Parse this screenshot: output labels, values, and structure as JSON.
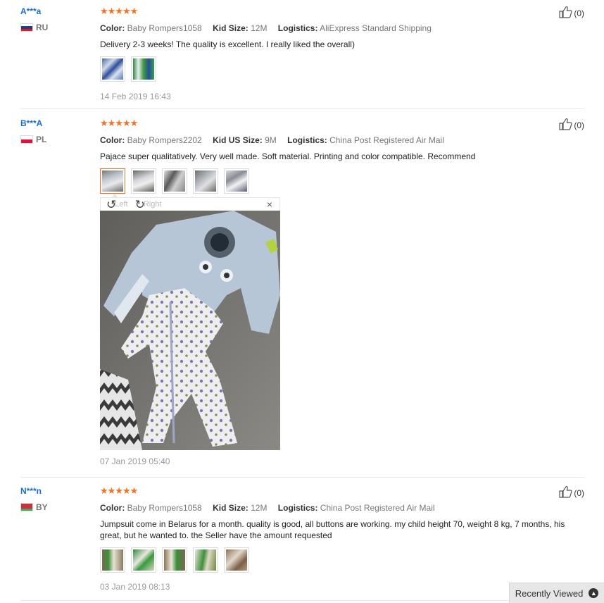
{
  "reviews": [
    {
      "user": "A***a",
      "country": "RU",
      "flag": [
        "#ffffff",
        "#1c3f94",
        "#e4181c"
      ],
      "stars": 5,
      "color_label": "Color:",
      "color_value": "Baby Rompers1058",
      "size_label": "Kid Size:",
      "size_value": "12M",
      "logistics_label": "Logistics:",
      "logistics_value": "AliExpress Standard Shipping",
      "text": "Delivery 2-3 weeks! The quality is excellent. I really liked the overall)",
      "date": "14 Feb 2019 16:43",
      "likes": "(0)"
    },
    {
      "user": "B***A",
      "country": "PL",
      "flag": [
        "#ffffff",
        "#ffffff",
        "#dc143c"
      ],
      "stars": 5,
      "color_label": "Color:",
      "color_value": "Baby Rompers2202",
      "size_label": "Kid US Size:",
      "size_value": "9M",
      "logistics_label": "Logistics:",
      "logistics_value": "China Post Registered Air Mail",
      "text": "Pajace super qualitatively. Very well made. Soft material. Printing and color compatible. Recommend",
      "date": "07 Jan 2019 05:40",
      "likes": "(0)"
    },
    {
      "user": "N***n",
      "country": "BY",
      "flag": [
        "#c8313e",
        "#c8313e",
        "#4aa657"
      ],
      "stars": 5,
      "color_label": "Color:",
      "color_value": "Baby Rompers1058",
      "size_label": "Kid Size:",
      "size_value": "12M",
      "logistics_label": "Logistics:",
      "logistics_value": "China Post Registered Air Mail",
      "text": "Jumpsuit come in Belarus for a month. quality is good, all buttons are working. my child height 70, weight 8 kg, 7 months, his great, but he wanted to. the Seller have the amount requested",
      "date": "03 Jan 2019 08:13",
      "likes": "(0)"
    }
  ],
  "viewer": {
    "rotate_left": "Left",
    "rotate_right": "Right",
    "close": "×"
  },
  "recently_viewed": "Recently Viewed",
  "icons": {
    "star": "star-icon",
    "thumbs_up": "thumbs-up-icon",
    "rotate_left": "rotate-left-icon",
    "rotate_right": "rotate-right-icon",
    "close": "close-icon",
    "chevron_up": "chevron-up-icon"
  },
  "colors": {
    "star": "#f57224",
    "username": "#1a6ec6",
    "active_thumb": "#f57224"
  }
}
